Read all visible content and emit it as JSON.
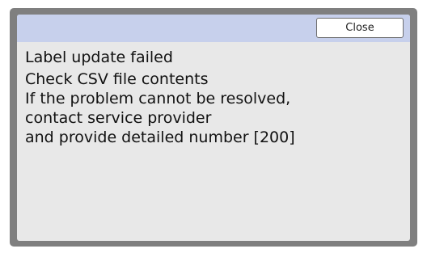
{
  "dialog": {
    "close_label": "Close",
    "lines": [
      "Label update failed",
      "Check CSV file contents",
      "If the problem cannot be resolved,",
      "contact service provider",
      "and provide detailed number [200]"
    ]
  }
}
